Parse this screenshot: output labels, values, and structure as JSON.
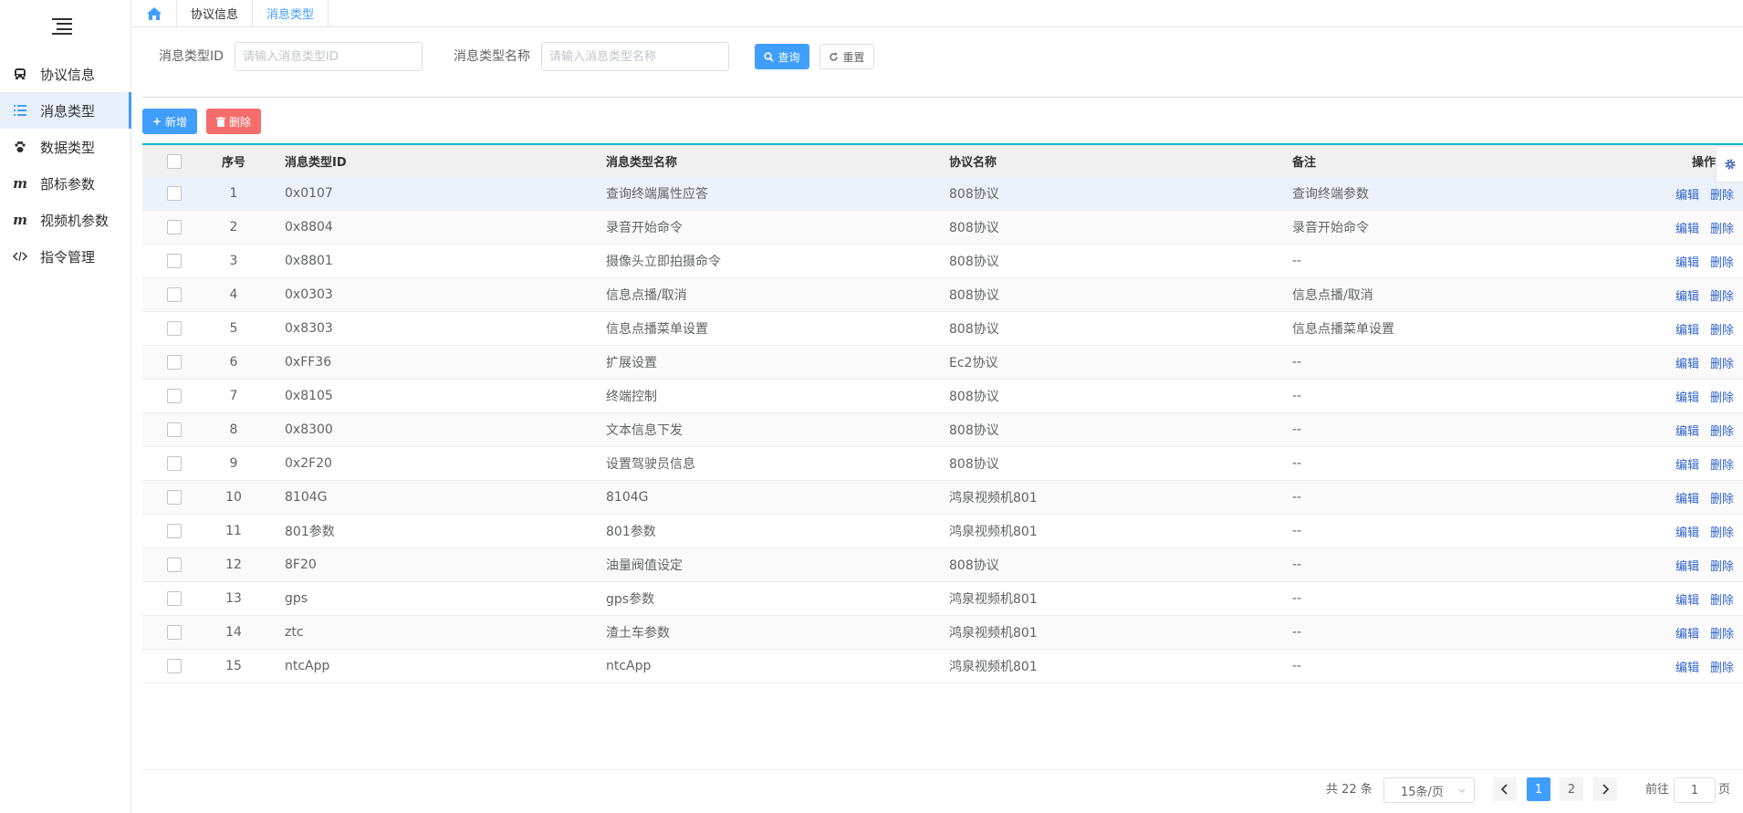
{
  "sidebar": {
    "items": [
      {
        "label": "协议信息",
        "icon": "bus-icon",
        "active": false
      },
      {
        "label": "消息类型",
        "icon": "list-icon",
        "active": true
      },
      {
        "label": "数据类型",
        "icon": "paw-icon",
        "active": false
      },
      {
        "label": "部标参数",
        "icon": "m-icon",
        "active": false
      },
      {
        "label": "视频机参数",
        "icon": "m-icon",
        "active": false
      },
      {
        "label": "指令管理",
        "icon": "code-icon",
        "active": false
      }
    ]
  },
  "tabs": [
    {
      "label": "协议信息",
      "active": false
    },
    {
      "label": "消息类型",
      "active": true
    }
  ],
  "search": {
    "id_label": "消息类型ID",
    "id_placeholder": "请输入消息类型ID",
    "id_value": "",
    "name_label": "消息类型名称",
    "name_placeholder": "请输入消息类型名称",
    "name_value": "",
    "query_label": "查询",
    "reset_label": "重置"
  },
  "actions": {
    "add_label": "新增",
    "delete_label": "删除"
  },
  "table": {
    "headers": {
      "index": "序号",
      "id": "消息类型ID",
      "name": "消息类型名称",
      "protocol": "协议名称",
      "note": "备注",
      "op": "操作"
    },
    "edit_label": "编辑",
    "delete_label": "删除",
    "rows": [
      {
        "index": "1",
        "id": "0x0107",
        "name": "查询终端属性应答",
        "protocol": "808协议",
        "note": "查询终端参数"
      },
      {
        "index": "2",
        "id": "0x8804",
        "name": "录音开始命令",
        "protocol": "808协议",
        "note": "录音开始命令"
      },
      {
        "index": "3",
        "id": "0x8801",
        "name": "摄像头立即拍摄命令",
        "protocol": "808协议",
        "note": "--"
      },
      {
        "index": "4",
        "id": "0x0303",
        "name": "信息点播/取消",
        "protocol": "808协议",
        "note": "信息点播/取消"
      },
      {
        "index": "5",
        "id": "0x8303",
        "name": "信息点播菜单设置",
        "protocol": "808协议",
        "note": "信息点播菜单设置"
      },
      {
        "index": "6",
        "id": "0xFF36",
        "name": "扩展设置",
        "protocol": "Ec2协议",
        "note": "--"
      },
      {
        "index": "7",
        "id": "0x8105",
        "name": "终端控制",
        "protocol": "808协议",
        "note": "--"
      },
      {
        "index": "8",
        "id": "0x8300",
        "name": "文本信息下发",
        "protocol": "808协议",
        "note": "--"
      },
      {
        "index": "9",
        "id": "0x2F20",
        "name": "设置驾驶员信息",
        "protocol": "808协议",
        "note": "--"
      },
      {
        "index": "10",
        "id": "8104G",
        "name": "8104G",
        "protocol": "鸿泉视频机801",
        "note": "--"
      },
      {
        "index": "11",
        "id": "801参数",
        "name": "801参数",
        "protocol": "鸿泉视频机801",
        "note": "--"
      },
      {
        "index": "12",
        "id": "8F20",
        "name": "油量阀值设定",
        "protocol": "808协议",
        "note": "--"
      },
      {
        "index": "13",
        "id": "gps",
        "name": "gps参数",
        "protocol": "鸿泉视频机801",
        "note": "--"
      },
      {
        "index": "14",
        "id": "ztc",
        "name": "渣土车参数",
        "protocol": "鸿泉视频机801",
        "note": "--"
      },
      {
        "index": "15",
        "id": "ntcApp",
        "name": "ntcApp",
        "protocol": "鸿泉视频机801",
        "note": "--"
      }
    ]
  },
  "pagination": {
    "total_text": "共 22 条",
    "page_size": "15条/页",
    "pages": [
      "1",
      "2"
    ],
    "current_page": "1",
    "goto_label": "前往",
    "goto_value": "1",
    "page_suffix": "页"
  },
  "colors": {
    "primary": "#409eff",
    "danger": "#f56c6c",
    "link": "#2e62cd",
    "table_accent": "#00b5d6"
  }
}
